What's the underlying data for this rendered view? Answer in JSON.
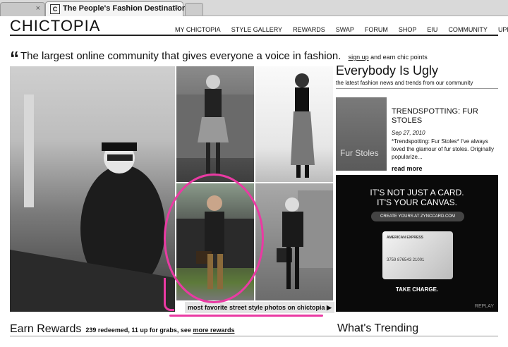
{
  "browser": {
    "tabs": [
      {
        "title": "",
        "close": "×"
      },
      {
        "favicon": "C",
        "title": "The People's Fashion Destination ...",
        "close": "×"
      }
    ]
  },
  "site": {
    "logo": "CHICTOPIA",
    "nav": [
      "MY CHICTOPIA",
      "STYLE GALLERY",
      "REWARDS",
      "SWAP",
      "FORUM",
      "SHOP",
      "EIU",
      "COMMUNITY",
      "UPDATE"
    ]
  },
  "tagline": {
    "quote_mark": "“",
    "text": "The largest online community that gives everyone a voice in fashion.",
    "signup_link": "sign up",
    "signup_suffix": "and earn chic points"
  },
  "feature": {
    "caption": "most favorite street style photos on chictopia ▶"
  },
  "blog": {
    "title": "Everybody Is Ugly",
    "subtitle": "the latest fashion news and trends from our community",
    "thumb_text": "Fur Stoles",
    "post_title": "TRENDSPOTTING: FUR STOLES",
    "post_date": "Sep 27, 2010",
    "post_excerpt": "*Trendspotting: Fur Stoles* I've always loved the glamour of fur stoles. Originally popularize...",
    "read_more": "read more"
  },
  "ad": {
    "line1": "IT'S NOT JUST A CARD.",
    "line2": "IT'S YOUR CANVAS.",
    "button": "CREATE YOURS AT ZYNCCARD.COM",
    "card_brand": "AMERICAN EXPRESS",
    "card_number": "3759 876543 21001",
    "tagline": "TAKE CHARGE.",
    "replay": "REPLAY"
  },
  "rewards": {
    "title": "Earn Rewards",
    "detail": "239 redeemed, 11 up for grabs, see",
    "link": "more rewards"
  },
  "trending": {
    "title": "What's Trending"
  },
  "colors": {
    "annotation": "#ea3aa3"
  }
}
